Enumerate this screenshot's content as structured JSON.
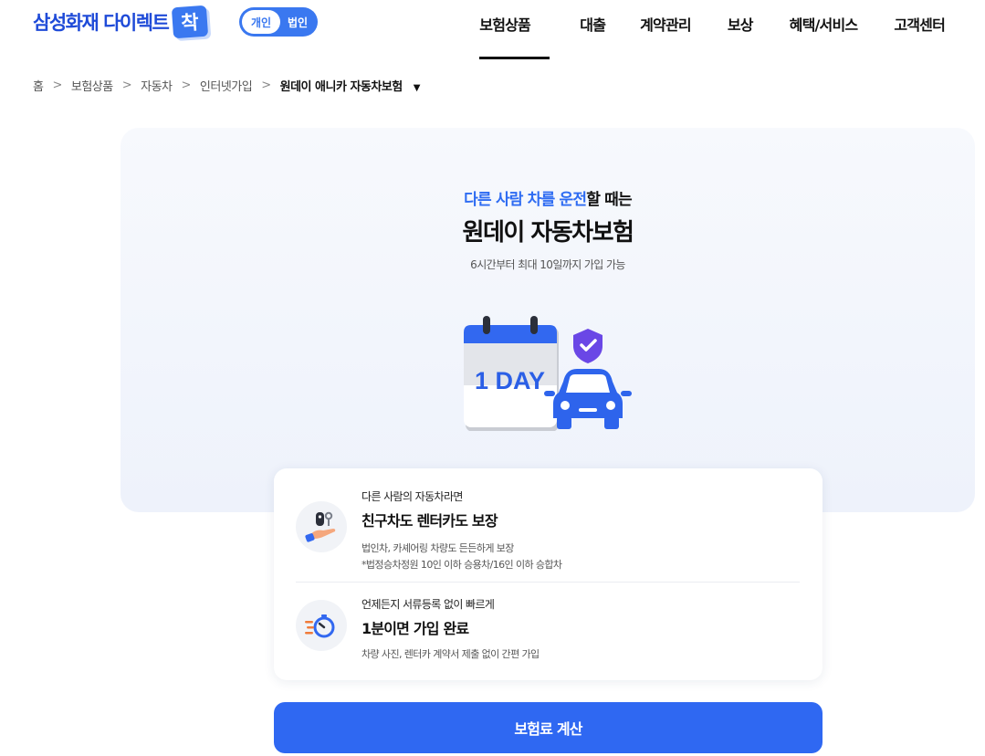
{
  "header": {
    "logo_text": "삼성화재 다이렉트",
    "logo_badge": "착",
    "customer_toggle": {
      "selected": "개인",
      "other": "법인"
    },
    "nav": [
      {
        "label": "보험상품",
        "active": true
      },
      {
        "label": "대출",
        "active": false
      },
      {
        "label": "계약관리",
        "active": false
      },
      {
        "label": "보상",
        "active": false
      },
      {
        "label": "혜택/서비스",
        "active": false
      },
      {
        "label": "고객센터",
        "active": false
      }
    ]
  },
  "breadcrumb": {
    "items": [
      "홈",
      "보험상품",
      "자동차",
      "인터넷가입"
    ],
    "current": "원데이 애니카 자동차보험",
    "separator": ">",
    "caret": "▼"
  },
  "hero": {
    "subtitle_highlight": "다른 사람 차를 운전",
    "subtitle_rest": "할 때는",
    "title": "원데이 자동차보험",
    "description": "6시간부터 최대 10일까지 가입 가능",
    "illustration_label": "1 DAY"
  },
  "features": [
    {
      "caption": "다른 사람의 자동차라면",
      "title": "친구차도 렌터카도 보장",
      "description": "법인차, 카셰어링 차량도 든든하게 보장",
      "note": "*법정승차정원 10인 이하 승용차/16인 이하 승합차",
      "icon": "car-key-hand-icon"
    },
    {
      "caption": "언제든지 서류등록 없이 빠르게",
      "title": "1분이면 가입 완료",
      "description": "차량 사진, 렌터카 계약서 제출 없이 간편 가입",
      "icon": "fast-timer-icon"
    }
  ],
  "cta": {
    "label": "보험료 계산"
  },
  "colors": {
    "brand": "#1f4bd8",
    "accent": "#2f68f2",
    "hero_bg": "#eef2fb",
    "text": "#111111"
  }
}
